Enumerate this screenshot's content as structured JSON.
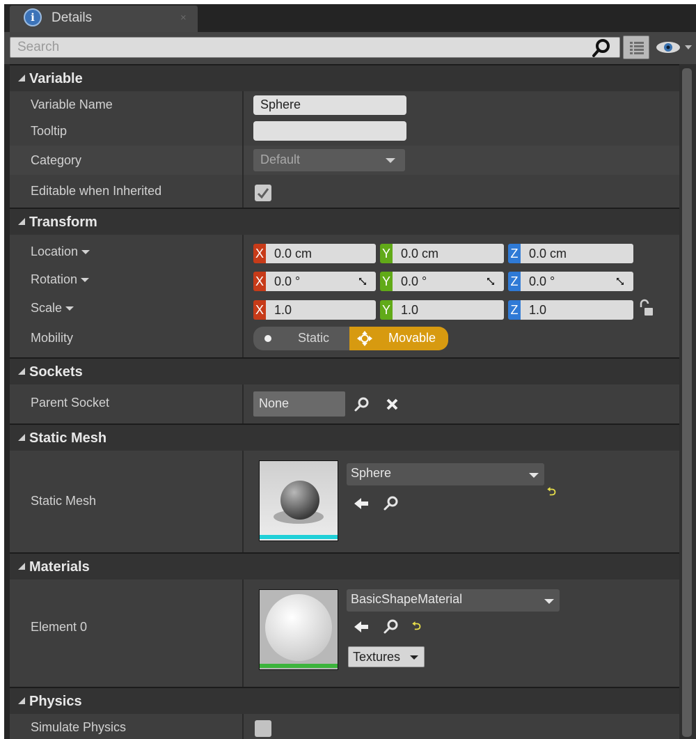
{
  "tab": {
    "title": "Details",
    "icon": "info-icon",
    "close": "×"
  },
  "search": {
    "placeholder": "Search"
  },
  "categories": {
    "variable": "Variable",
    "transform": "Transform",
    "sockets": "Sockets",
    "static_mesh": "Static Mesh",
    "materials": "Materials",
    "physics": "Physics"
  },
  "variable": {
    "name_label": "Variable Name",
    "name_value": "Sphere",
    "tooltip_label": "Tooltip",
    "tooltip_value": "",
    "category_label": "Category",
    "category_value": "Default",
    "editable_label": "Editable when Inherited",
    "editable_checked": true
  },
  "transform": {
    "location_label": "Location",
    "rotation_label": "Rotation",
    "scale_label": "Scale",
    "mobility_label": "Mobility",
    "location": {
      "x": "0.0 cm",
      "y": "0.0 cm",
      "z": "0.0 cm"
    },
    "rotation": {
      "x": "0.0 °",
      "y": "0.0 °",
      "z": "0.0 °"
    },
    "scale": {
      "x": "1.0",
      "y": "1.0",
      "z": "1.0"
    },
    "axis_letters": {
      "x": "X",
      "y": "Y",
      "z": "Z"
    },
    "mobility_options": {
      "static": "Static",
      "movable": "Movable"
    },
    "mobility_selected": "Movable"
  },
  "sockets": {
    "parent_label": "Parent Socket",
    "parent_value": "None"
  },
  "static_mesh": {
    "label": "Static Mesh",
    "value": "Sphere"
  },
  "materials": {
    "element_label": "Element 0",
    "value": "BasicShapeMaterial",
    "textures_button": "Textures"
  },
  "physics": {
    "simulate_label": "Simulate Physics",
    "simulate_checked": false
  },
  "colors": {
    "axis_x": "#c73b19",
    "axis_y": "#61aa18",
    "axis_z": "#2f7ad6",
    "movable_active": "#d79a10",
    "mesh_thumb_bar": "#20d0d8",
    "material_thumb_bar": "#3cb43c"
  }
}
